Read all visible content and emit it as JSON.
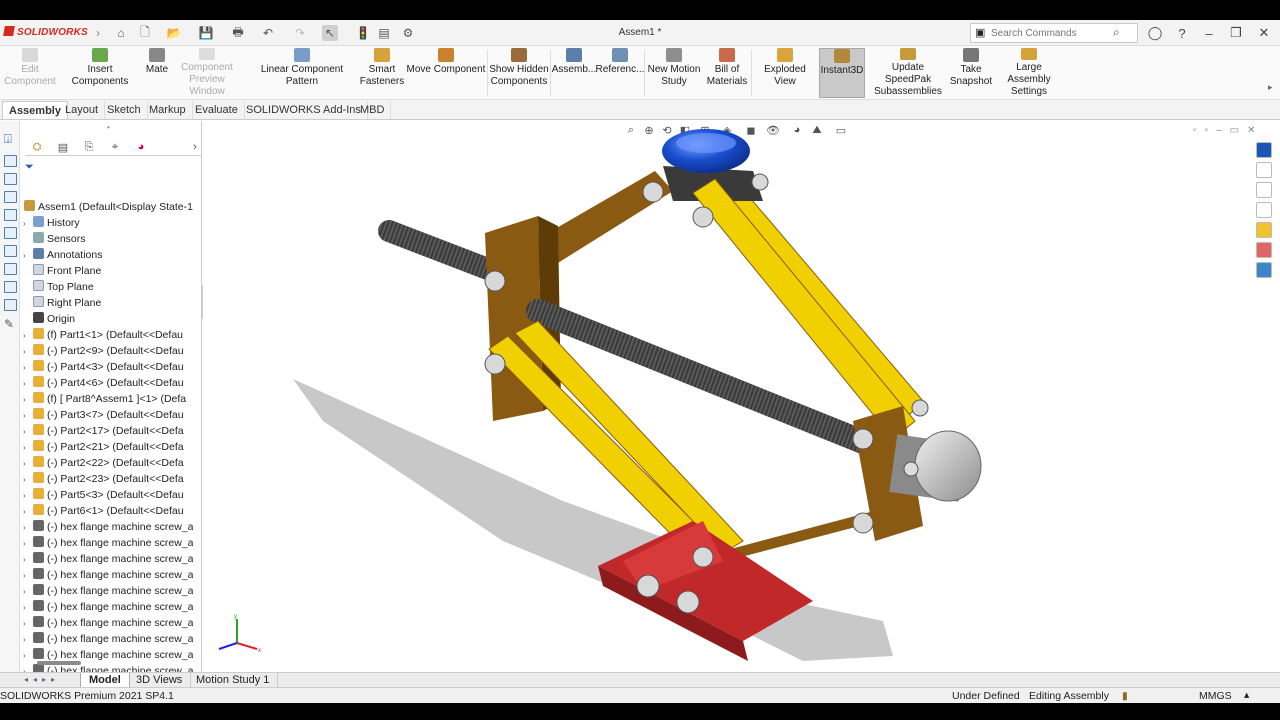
{
  "app": {
    "name": "SOLIDWORKS",
    "document_title": "Assem1 *"
  },
  "search": {
    "placeholder": "Search Commands"
  },
  "ribbon": {
    "items": [
      {
        "label": "Edit\nComponent",
        "disabled": true
      },
      {
        "label": "Insert Components"
      },
      {
        "label": "Mate"
      },
      {
        "label": "Component\nPreview Window",
        "disabled": true
      },
      {
        "label": "Linear Component Pattern"
      },
      {
        "label": "Smart\nFasteners"
      },
      {
        "label": "Move Component"
      },
      {
        "label": "Show Hidden\nComponents"
      },
      {
        "label": "Assemb..."
      },
      {
        "label": "Referenc..."
      },
      {
        "label": "New Motion\nStudy"
      },
      {
        "label": "Bill of\nMaterials"
      },
      {
        "label": "Exploded View"
      },
      {
        "label": "Instant3D",
        "active": true
      },
      {
        "label": "Update SpeedPak\nSubassemblies"
      },
      {
        "label": "Take\nSnapshot"
      },
      {
        "label": "Large Assembly\nSettings"
      }
    ]
  },
  "tabs": [
    "Assembly",
    "Layout",
    "Sketch",
    "Markup",
    "Evaluate",
    "SOLIDWORKS Add-Ins",
    "MBD"
  ],
  "tree": {
    "root": "Assem1  (Default<Display State-1",
    "items": [
      {
        "label": "History",
        "expand": true,
        "icon": "folder"
      },
      {
        "label": "Sensors",
        "expand": false,
        "icon": "sensor"
      },
      {
        "label": "Annotations",
        "expand": true,
        "icon": "annotation"
      },
      {
        "label": "Front Plane",
        "expand": false,
        "icon": "plane"
      },
      {
        "label": "Top Plane",
        "expand": false,
        "icon": "plane"
      },
      {
        "label": "Right Plane",
        "expand": false,
        "icon": "plane"
      },
      {
        "label": "Origin",
        "expand": false,
        "icon": "origin"
      },
      {
        "label": "(f) Part1<1> (Default<<Defau",
        "expand": true,
        "icon": "part"
      },
      {
        "label": "(-) Part2<9> (Default<<Defau",
        "expand": true,
        "icon": "part"
      },
      {
        "label": "(-) Part4<3> (Default<<Defau",
        "expand": true,
        "icon": "part"
      },
      {
        "label": "(-) Part4<6> (Default<<Defau",
        "expand": true,
        "icon": "part"
      },
      {
        "label": "(f) [ Part8^Assem1 ]<1> (Defa",
        "expand": true,
        "icon": "part"
      },
      {
        "label": "(-) Part3<7> (Default<<Defau",
        "expand": true,
        "icon": "part"
      },
      {
        "label": "(-) Part2<17> (Default<<Defa",
        "expand": true,
        "icon": "part"
      },
      {
        "label": "(-) Part2<21> (Default<<Defa",
        "expand": true,
        "icon": "part"
      },
      {
        "label": "(-) Part2<22> (Default<<Defa",
        "expand": true,
        "icon": "part"
      },
      {
        "label": "(-) Part2<23> (Default<<Defa",
        "expand": true,
        "icon": "part"
      },
      {
        "label": "(-) Part5<3> (Default<<Defau",
        "expand": true,
        "icon": "part"
      },
      {
        "label": "(-) Part6<1> (Default<<Defau",
        "expand": true,
        "icon": "part"
      },
      {
        "label": "(-) hex flange machine screw_a",
        "expand": true,
        "icon": "screw"
      },
      {
        "label": "(-) hex flange machine screw_a",
        "expand": true,
        "icon": "screw"
      },
      {
        "label": "(-) hex flange machine screw_a",
        "expand": true,
        "icon": "screw"
      },
      {
        "label": "(-) hex flange machine screw_a",
        "expand": true,
        "icon": "screw"
      },
      {
        "label": "(-) hex flange machine screw_a",
        "expand": true,
        "icon": "screw"
      },
      {
        "label": "(-) hex flange machine screw_a",
        "expand": true,
        "icon": "screw"
      },
      {
        "label": "(-) hex flange machine screw_a",
        "expand": true,
        "icon": "screw"
      },
      {
        "label": "(-) hex flange machine screw_a",
        "expand": true,
        "icon": "screw"
      },
      {
        "label": "(-) hex flange machine screw_a",
        "expand": true,
        "icon": "screw"
      },
      {
        "label": "(-) hex flange machine screw_a",
        "expand": true,
        "icon": "screw"
      }
    ]
  },
  "bottom_tabs": [
    "Model",
    "3D Views",
    "Motion Study 1"
  ],
  "status": {
    "product": "SOLIDWORKS Premium 2021 SP4.1",
    "definition": "Under Defined",
    "mode": "Editing Assembly",
    "units": "MMGS"
  },
  "colors": {
    "brand": "#d42a20",
    "link_yellow": "#f0d000",
    "link_brown": "#8a5a12",
    "base_red": "#c0282a",
    "cap_blue": "#1a4fd0"
  },
  "icons": [
    "home-icon",
    "new-icon",
    "open-icon",
    "save-icon",
    "print-icon",
    "undo-icon",
    "redo-icon",
    "select-icon",
    "options-icon",
    "help-icon",
    "user-icon"
  ]
}
